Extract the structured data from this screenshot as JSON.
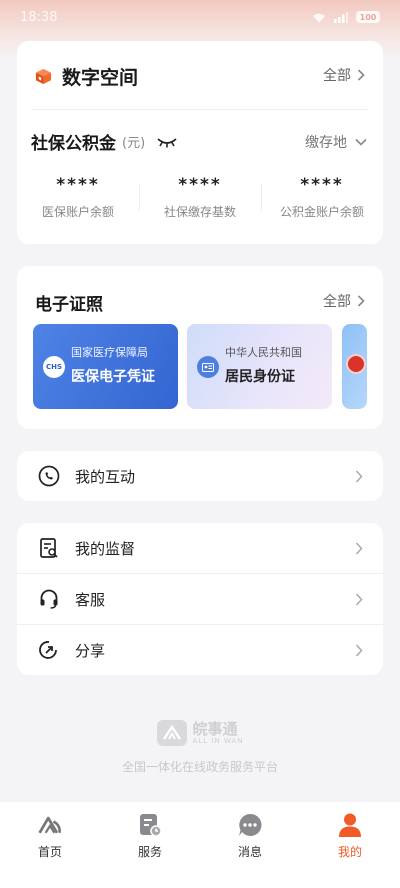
{
  "status_bar": {
    "time": "18:38",
    "battery": "100"
  },
  "digital_space": {
    "title": "数字空间",
    "all_label": "全部",
    "fund": {
      "title": "社保公积金",
      "unit": "(元)",
      "region_label": "缴存地",
      "stats": [
        {
          "value": "****",
          "label": "医保账户余额"
        },
        {
          "value": "****",
          "label": "社保缴存基数"
        },
        {
          "value": "****",
          "label": "公积金账户余额"
        }
      ]
    }
  },
  "certificates": {
    "title": "电子证照",
    "all_label": "全部",
    "items": [
      {
        "org": "国家医疗保障局",
        "name": "医保电子凭证",
        "logo_text": "CHS"
      },
      {
        "org": "中华人民共和国",
        "name": "居民身份证"
      }
    ]
  },
  "interact": {
    "label": "我的互动"
  },
  "menu": [
    {
      "label": "我的监督",
      "icon": "document-search-icon"
    },
    {
      "label": "客服",
      "icon": "headset-icon"
    },
    {
      "label": "分享",
      "icon": "share-icon"
    }
  ],
  "brand": {
    "name": "皖事通",
    "sub": "ALL IN WAN",
    "slogan": "全国一体化在线政务服务平台"
  },
  "tabbar": [
    {
      "label": "首页",
      "icon": "home-logo-icon"
    },
    {
      "label": "服务",
      "icon": "service-icon"
    },
    {
      "label": "消息",
      "icon": "message-icon"
    },
    {
      "label": "我的",
      "icon": "profile-icon",
      "active": true
    }
  ],
  "colors": {
    "accent": "#f25a28",
    "med_card": "#3c6fd9"
  }
}
